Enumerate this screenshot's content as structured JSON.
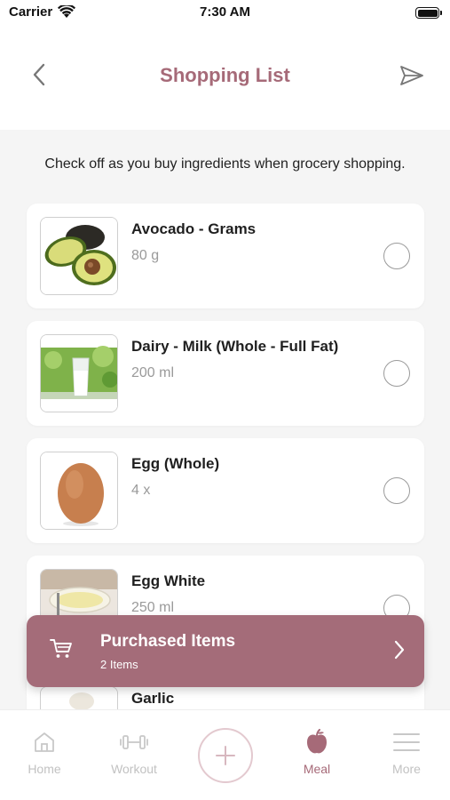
{
  "status_bar": {
    "carrier": "Carrier",
    "time": "7:30 AM"
  },
  "nav": {
    "title": "Shopping List"
  },
  "hint": "Check off as you buy ingredients when grocery shopping.",
  "items": [
    {
      "name": "Avocado - Grams",
      "qty": "80 g"
    },
    {
      "name": "Dairy - Milk (Whole - Full Fat)",
      "qty": "200 ml"
    },
    {
      "name": "Egg (Whole)",
      "qty": "4 x"
    },
    {
      "name": "Egg White",
      "qty": "250 ml"
    },
    {
      "name": "Garlic",
      "qty": ""
    }
  ],
  "purchased": {
    "title": "Purchased Items",
    "count": "2 Items"
  },
  "tabs": [
    {
      "label": "Home",
      "icon": "home-icon"
    },
    {
      "label": "Workout",
      "icon": "dumbbell-icon"
    },
    {
      "label": "Meal",
      "icon": "apple-icon"
    },
    {
      "label": "More",
      "icon": "menu-icon"
    }
  ],
  "colors": {
    "accent": "#a66a78",
    "banner": "#a46c79",
    "background": "#f5f5f5"
  }
}
